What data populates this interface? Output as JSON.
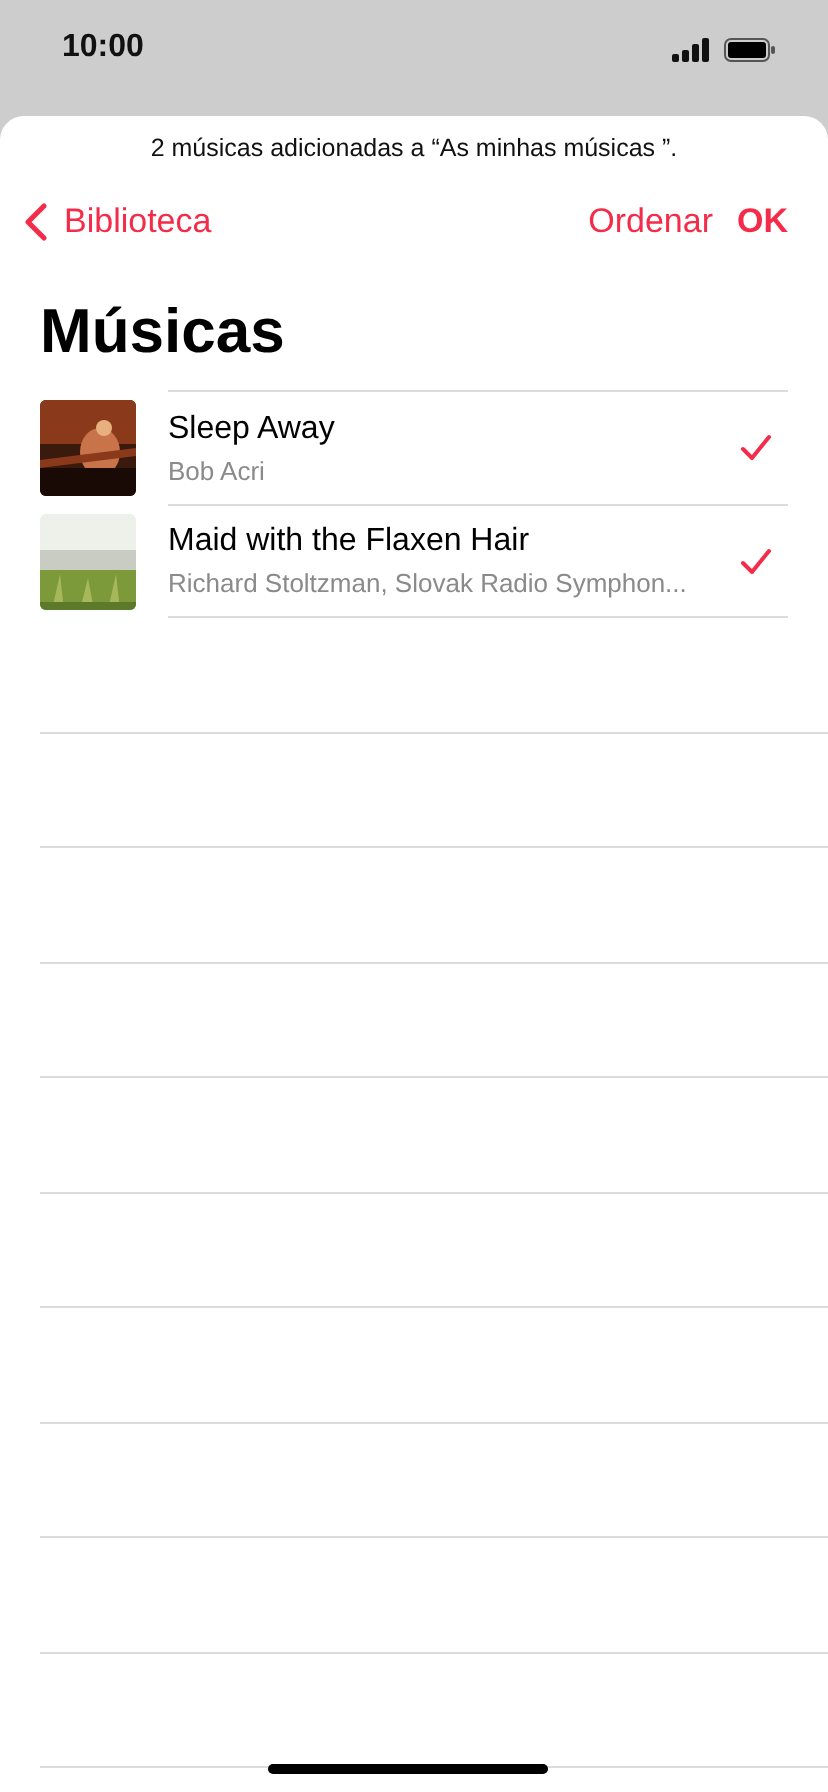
{
  "status_bar": {
    "time": "10:00"
  },
  "toast": {
    "text": "2 músicas adicionadas a “As minhas músicas ”."
  },
  "nav": {
    "back": "Biblioteca",
    "actions": [
      {
        "label": "Ordenar",
        "kind": "plain"
      },
      {
        "label": "OK",
        "kind": "bold"
      }
    ]
  },
  "title": "Músicas",
  "songs": [
    {
      "title": "Sleep Away",
      "artist": "Bob Acri",
      "checked": true
    },
    {
      "title": "Maid with the Flaxen Hair",
      "artist": "Richard Stoltzman, Slovak Radio Symphon...",
      "checked": true
    }
  ]
}
